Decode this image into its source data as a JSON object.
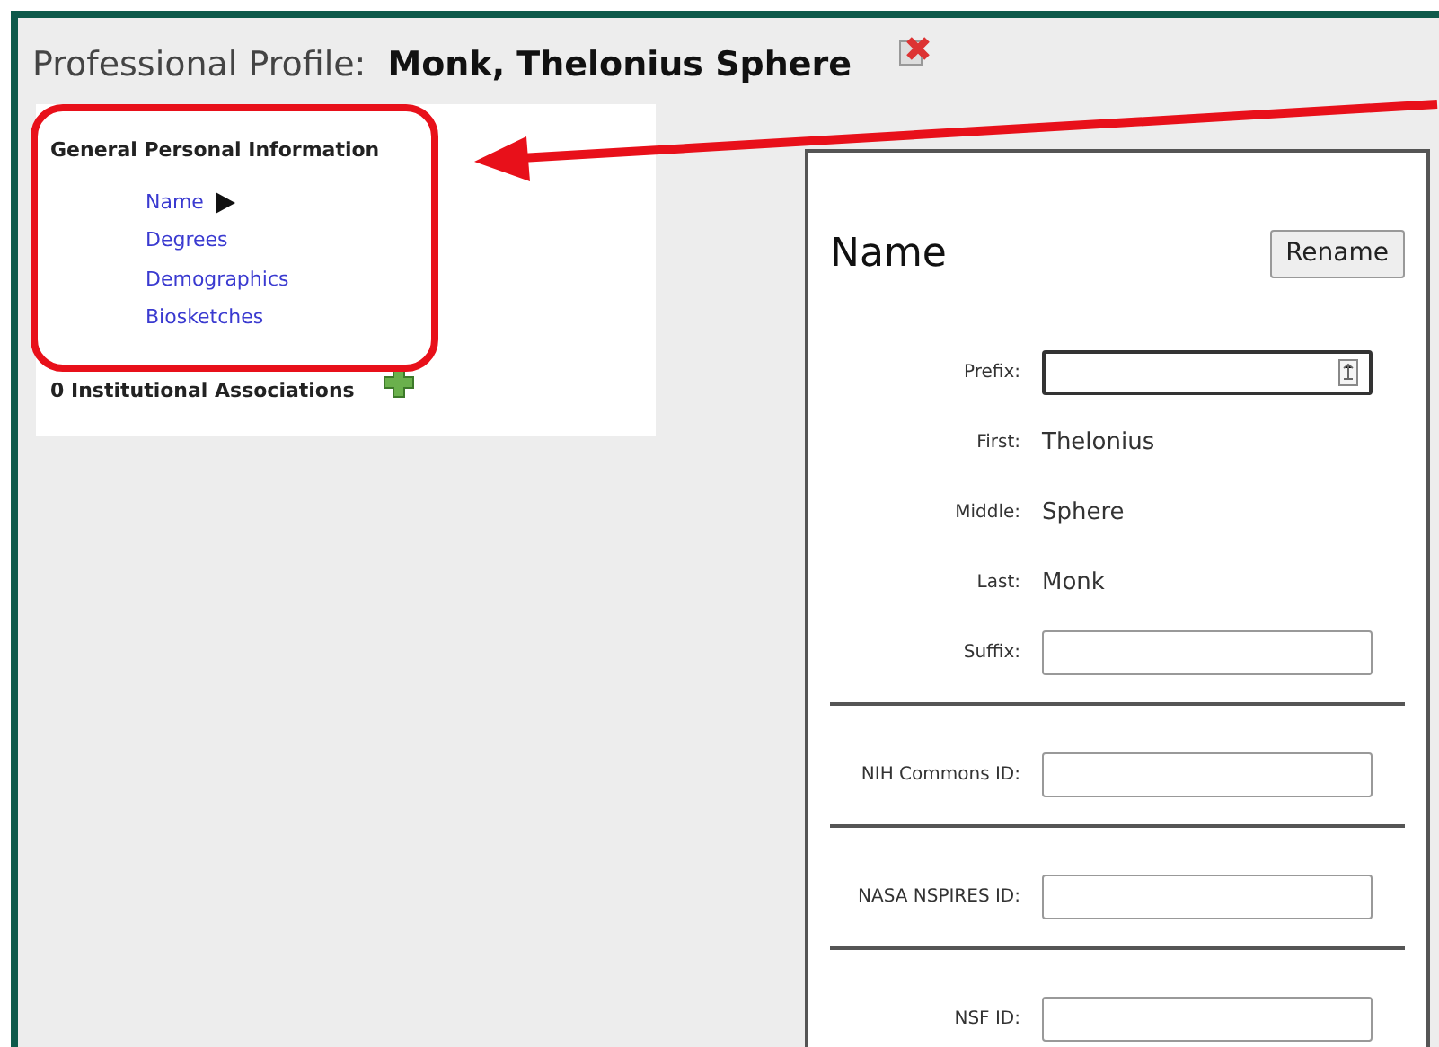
{
  "header": {
    "label": "Professional Profile:",
    "person": "Monk, Thelonius Sphere"
  },
  "sidebar": {
    "heading": "General Personal Information",
    "items": [
      {
        "label": "Name",
        "selected": true
      },
      {
        "label": "Degrees",
        "selected": false
      },
      {
        "label": "Demographics",
        "selected": false
      },
      {
        "label": "Biosketches",
        "selected": false
      }
    ],
    "associations": "0 Institutional Associations"
  },
  "panel": {
    "title": "Name",
    "button": "Rename",
    "sections": [
      {
        "fields": [
          {
            "kind": "select",
            "label": "Prefix:"
          },
          {
            "kind": "text",
            "label": "First:",
            "value": "Thelonius"
          },
          {
            "kind": "text",
            "label": "Middle:",
            "value": "Sphere"
          },
          {
            "kind": "text",
            "label": "Last:",
            "value": "Monk"
          },
          {
            "kind": "input",
            "label": "Suffix:"
          }
        ]
      },
      {
        "fields": [
          {
            "kind": "input",
            "label": "NIH Commons ID:"
          }
        ]
      },
      {
        "fields": [
          {
            "kind": "input",
            "label": "NASA NSPIRES ID:"
          }
        ]
      },
      {
        "fields": [
          {
            "kind": "input",
            "label": "NSF ID:"
          }
        ]
      }
    ]
  }
}
